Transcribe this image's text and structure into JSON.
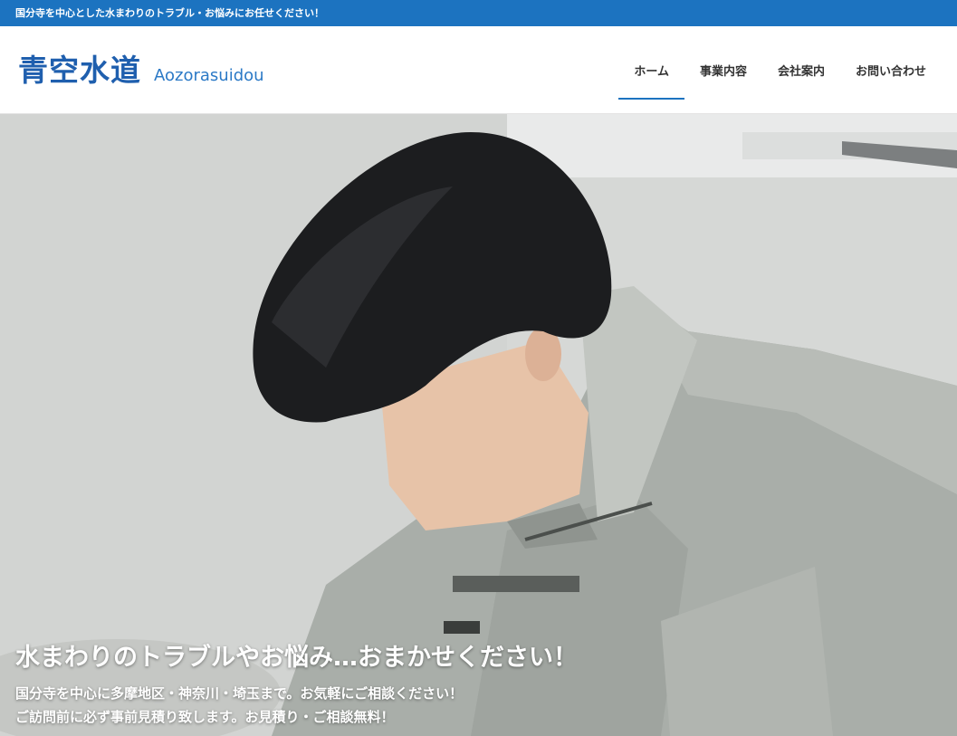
{
  "topbar": {
    "text": "国分寺を中心とした水まわりのトラブル・お悩みにお任せください！"
  },
  "header": {
    "logo_jp": "青空水道",
    "logo_en": "Aozorasuidou",
    "nav": [
      {
        "label": "ホーム",
        "active": true
      },
      {
        "label": "事業内容",
        "active": false
      },
      {
        "label": "会社案内",
        "active": false
      },
      {
        "label": "お問い合わせ",
        "active": false
      }
    ]
  },
  "hero": {
    "title": "水まわりのトラブルやお悩み…おまかせください！",
    "sub_line1": "国分寺を中心に多摩地区・神奈川・埼玉まで。お気軽にご相談ください！",
    "sub_line2": "ご訪問前に必ず事前見積り致します。お見積り・ご相談無料！"
  },
  "colors": {
    "brand_blue": "#1c73c0",
    "logo_blue": "#1f5fae"
  }
}
